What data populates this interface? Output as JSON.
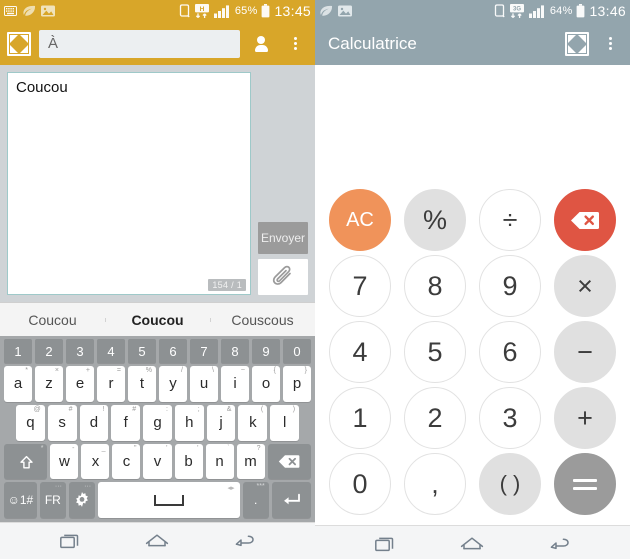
{
  "left": {
    "status": {
      "icons": [
        "keyboard-icon",
        "leaf-icon",
        "image-icon",
        "sim-icon",
        "hplus-data-icon",
        "signal-icon"
      ],
      "battery_percent": "65%",
      "clock": "13:45",
      "network_label": "H"
    },
    "appbar": {
      "multiwindow_icon": "shrink-icon",
      "to_placeholder": "À",
      "contact_icon": "person-icon",
      "overflow_icon": "overflow-menu-icon"
    },
    "compose": {
      "message_text": "Coucou",
      "char_counter": "154 / 1",
      "send_label": "Envoyer",
      "attach_icon": "paperclip-icon"
    },
    "suggestions": [
      "Coucou",
      "Coucou",
      "Couscous"
    ],
    "keyboard": {
      "numbers": [
        "1",
        "2",
        "3",
        "4",
        "5",
        "6",
        "7",
        "8",
        "9",
        "0"
      ],
      "row1": [
        {
          "key": "a",
          "sup": "*"
        },
        {
          "key": "z",
          "sup": "×"
        },
        {
          "key": "e",
          "sup": "+"
        },
        {
          "key": "r",
          "sup": "="
        },
        {
          "key": "t",
          "sup": "%"
        },
        {
          "key": "y",
          "sup": "/"
        },
        {
          "key": "u",
          "sup": "\\"
        },
        {
          "key": "i",
          "sup": "~"
        },
        {
          "key": "o",
          "sup": "{"
        },
        {
          "key": "p",
          "sup": "}"
        }
      ],
      "row2": [
        {
          "key": "q",
          "sup": "@"
        },
        {
          "key": "s",
          "sup": "#"
        },
        {
          "key": "d",
          "sup": "!"
        },
        {
          "key": "f",
          "sup": "#"
        },
        {
          "key": "g",
          "sup": ":"
        },
        {
          "key": "h",
          "sup": ";"
        },
        {
          "key": "j",
          "sup": "&"
        },
        {
          "key": "k",
          "sup": "("
        },
        {
          "key": "l",
          "sup": ")"
        }
      ],
      "row3": [
        {
          "key": "w",
          "sup": "-"
        },
        {
          "key": "x",
          "sup": "_"
        },
        {
          "key": "c",
          "sup": "\""
        },
        {
          "key": "v",
          "sup": "'"
        },
        {
          "key": "b",
          "sup": "'"
        },
        {
          "key": "n",
          "sup": "`"
        },
        {
          "key": "m",
          "sup": "?"
        }
      ],
      "shift_icon": "shift-icon",
      "shift_sup": "*",
      "backspace_icon": "backspace-icon",
      "symbols_label": "☺1#",
      "language_label": "FR",
      "settings_icon": "gear-icon",
      "space_label": "space-bar",
      "period_label": ".",
      "period_sup": "***",
      "enter_icon": "enter-icon"
    },
    "nav": [
      "recents-icon",
      "home-icon",
      "back-icon"
    ]
  },
  "right": {
    "status": {
      "icons": [
        "leaf-icon",
        "image-icon",
        "sim-icon",
        "3g-data-icon",
        "signal-icon"
      ],
      "battery_percent": "64%",
      "clock": "13:46",
      "network_label": "3G"
    },
    "appbar": {
      "title": "Calculatrice",
      "multiwindow_icon": "shrink-icon",
      "overflow_icon": "overflow-menu-icon"
    },
    "calculator": {
      "display_value": "",
      "rows": [
        [
          {
            "label": "AC",
            "style": "orange",
            "name": "all-clear-button"
          },
          {
            "label": "%",
            "style": "grey",
            "name": "percent-button"
          },
          {
            "label": "÷",
            "style": "grey-outline",
            "name": "divide-button"
          },
          {
            "label": "",
            "style": "red",
            "name": "backspace-button",
            "icon": "backspace-icon"
          }
        ],
        [
          {
            "label": "7",
            "style": "plain",
            "name": "digit-7-button"
          },
          {
            "label": "8",
            "style": "plain",
            "name": "digit-8-button"
          },
          {
            "label": "9",
            "style": "plain",
            "name": "digit-9-button"
          },
          {
            "label": "×",
            "style": "grey",
            "name": "multiply-button"
          }
        ],
        [
          {
            "label": "4",
            "style": "plain",
            "name": "digit-4-button"
          },
          {
            "label": "5",
            "style": "plain",
            "name": "digit-5-button"
          },
          {
            "label": "6",
            "style": "plain",
            "name": "digit-6-button"
          },
          {
            "label": "−",
            "style": "grey",
            "name": "minus-button"
          }
        ],
        [
          {
            "label": "1",
            "style": "plain",
            "name": "digit-1-button"
          },
          {
            "label": "2",
            "style": "plain",
            "name": "digit-2-button"
          },
          {
            "label": "3",
            "style": "plain",
            "name": "digit-3-button"
          },
          {
            "label": "+",
            "style": "grey",
            "name": "plus-button"
          }
        ],
        [
          {
            "label": "0",
            "style": "plain",
            "name": "digit-0-button"
          },
          {
            "label": ",",
            "style": "plain",
            "name": "decimal-comma-button"
          },
          {
            "label": "( )",
            "style": "grey",
            "name": "parenthesis-button"
          },
          {
            "label": "=",
            "style": "dark",
            "name": "equals-button"
          }
        ]
      ]
    },
    "nav": [
      "recents-icon",
      "home-icon",
      "back-icon"
    ]
  },
  "colors": {
    "left_accent": "#d8a629",
    "right_accent": "#93a5ad",
    "calc_orange": "#f0935a",
    "calc_red": "#df5543",
    "calc_dark": "#9b9b9b",
    "compose_bg": "#cfd3d6",
    "keyboard_bg": "#a5a8aa"
  }
}
